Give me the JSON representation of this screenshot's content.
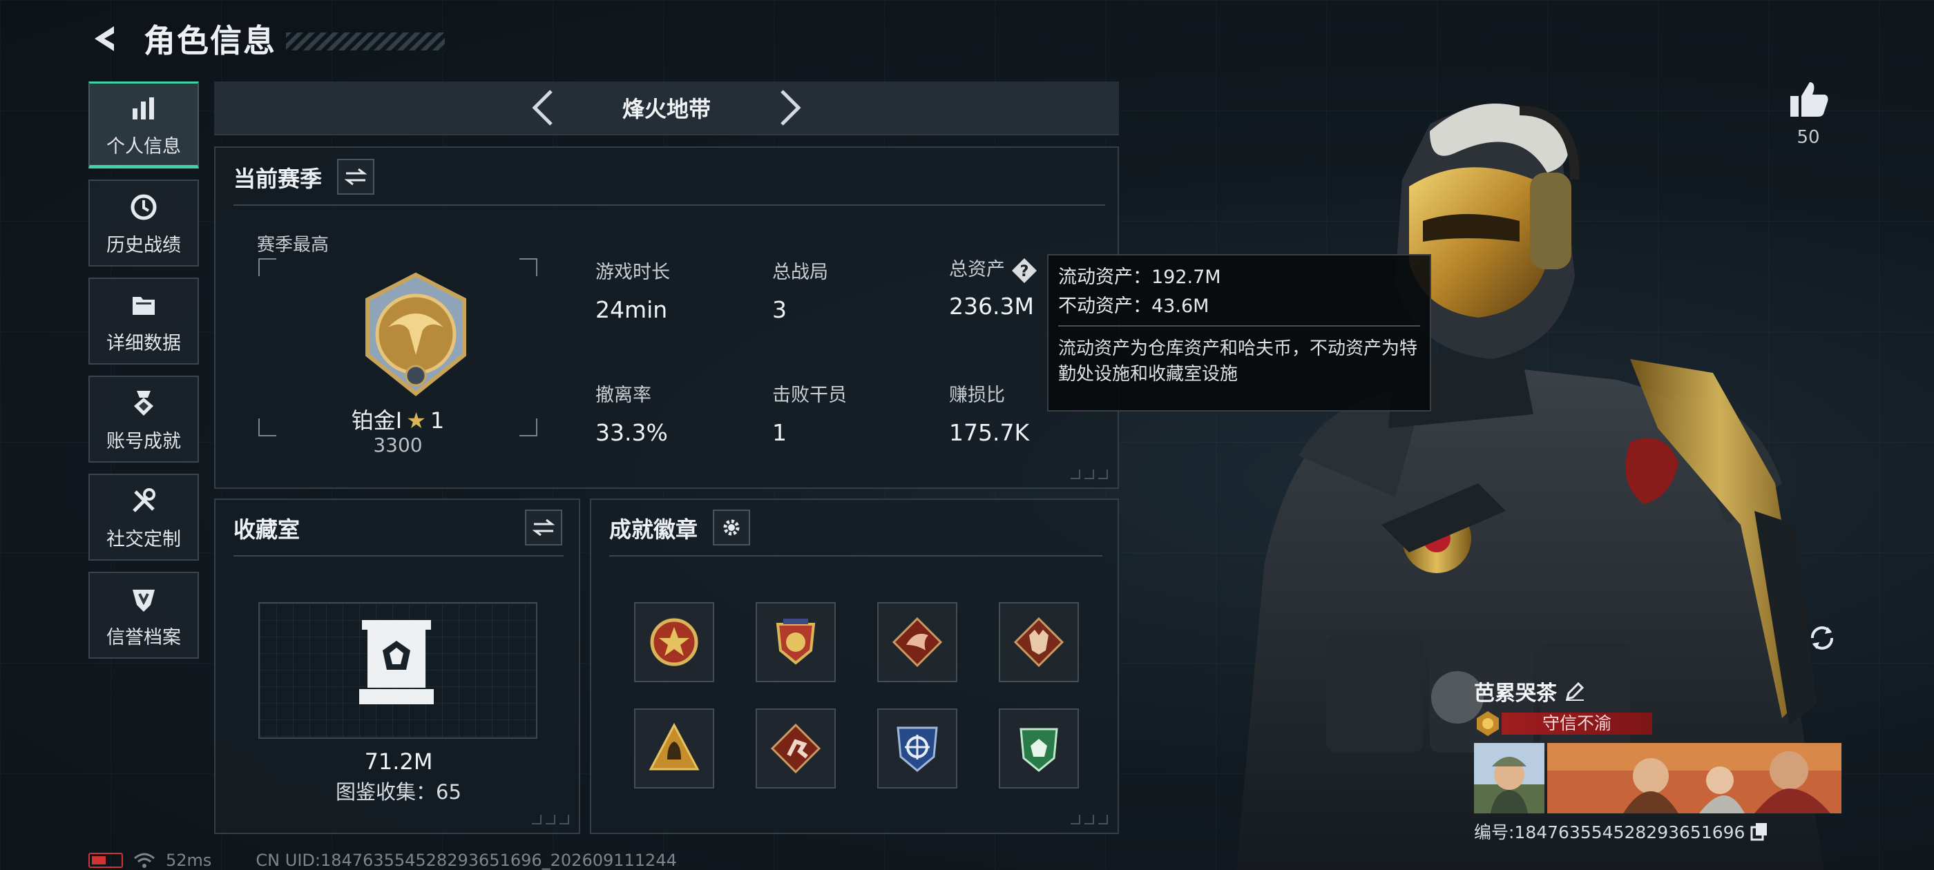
{
  "header": {
    "title": "角色信息",
    "back_icon": "back-arrow-icon"
  },
  "sidebar": {
    "items": [
      {
        "label": "个人信息",
        "icon": "bar-chart-icon",
        "active": true
      },
      {
        "label": "历史战绩",
        "icon": "clock-icon",
        "active": false
      },
      {
        "label": "详细数据",
        "icon": "folder-icon",
        "active": false
      },
      {
        "label": "账号成就",
        "icon": "medal-icon",
        "active": false
      },
      {
        "label": "社交定制",
        "icon": "tools-icon",
        "active": false
      },
      {
        "label": "信誉档案",
        "icon": "shield-icon",
        "active": false
      }
    ]
  },
  "mode_bar": {
    "name": "烽火地带"
  },
  "season": {
    "title": "当前赛季",
    "best_label": "赛季最高",
    "rank_name": "铂金Ⅰ",
    "rank_stars": "1",
    "rank_score": "3300",
    "stats": [
      {
        "label": "游戏时长",
        "value": "24min"
      },
      {
        "label": "总战局",
        "value": "3"
      },
      {
        "label": "总资产",
        "value": "236.3M"
      },
      {
        "label": "撤离率",
        "value": "33.3%"
      },
      {
        "label": "击败干员",
        "value": "1"
      },
      {
        "label": "赚损比",
        "value": "175.7K"
      }
    ]
  },
  "tooltip": {
    "line1": "流动资产：192.7M",
    "line2": "不动资产：43.6M",
    "note": "流动资产为仓库资产和哈夫币，不动资产为特勤处设施和收藏室设施"
  },
  "collection": {
    "title": "收藏室",
    "value": "71.2M",
    "count_text": "图鉴收集：65"
  },
  "badges": {
    "title": "成就徽章",
    "items": [
      "star-badge-icon",
      "wing-badge-icon",
      "dragon-badge-icon",
      "wolf-badge-icon",
      "bell-badge-icon",
      "runner-badge-icon",
      "crosshair-badge-icon",
      "shield-badge-icon"
    ]
  },
  "status": {
    "ping": "52ms",
    "uid": "CN UID:184763554528293651696_202609111244"
  },
  "character": {
    "likes": "50"
  },
  "player": {
    "name": "芭累哭茶",
    "title": "守信不渝",
    "id": "编号:184763554528293651696"
  },
  "colors": {
    "accent": "#3fd3a6",
    "title_badge": "#9f1d1f",
    "gold": "#d9b55a"
  }
}
